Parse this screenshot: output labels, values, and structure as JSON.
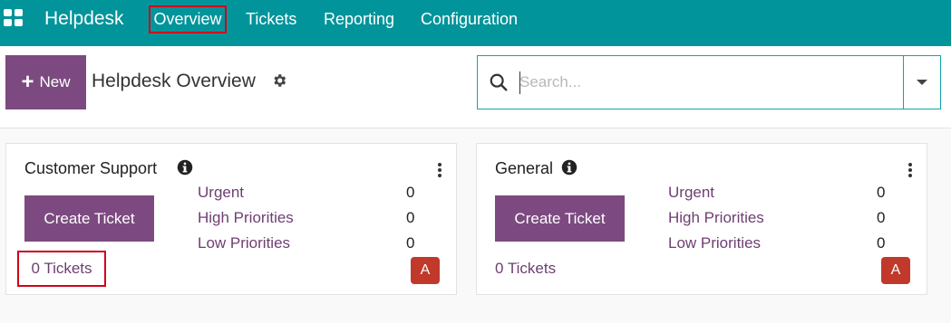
{
  "navbar": {
    "brand": "Helpdesk",
    "items": [
      {
        "label": "Overview"
      },
      {
        "label": "Tickets"
      },
      {
        "label": "Reporting"
      },
      {
        "label": "Configuration"
      }
    ],
    "color": "#01949a",
    "highlight_color": "#d0021b"
  },
  "control_panel": {
    "new_label": "New",
    "title": "Helpdesk Overview",
    "search": {
      "placeholder": "Search...",
      "value": ""
    }
  },
  "teams": [
    {
      "name": "Customer Support",
      "create_label": "Create Ticket",
      "priorities": [
        {
          "label": "Urgent",
          "count": "0"
        },
        {
          "label": "High Priorities",
          "count": "0"
        },
        {
          "label": "Low Priorities",
          "count": "0"
        }
      ],
      "tickets_label": "0 Tickets",
      "avatar": "A"
    },
    {
      "name": "General",
      "create_label": "Create Ticket",
      "priorities": [
        {
          "label": "Urgent",
          "count": "0"
        },
        {
          "label": "High Priorities",
          "count": "0"
        },
        {
          "label": "Low Priorities",
          "count": "0"
        }
      ],
      "tickets_label": "0 Tickets",
      "avatar": "A"
    }
  ],
  "colors": {
    "accent": "#7c4a80",
    "avatar": "#c0392b"
  }
}
